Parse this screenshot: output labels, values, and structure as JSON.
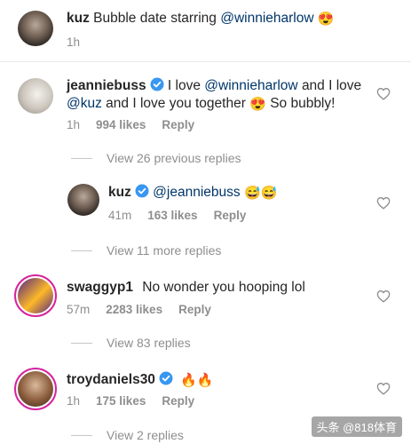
{
  "caption": {
    "username": "kuz",
    "text": "Bubble date starring",
    "mention": "@winnieharlow",
    "emoji": "😍",
    "time": "1h"
  },
  "comments": [
    {
      "username": "jeanniebuss",
      "line1_text_a": "I love",
      "line1_mention": "@winnieharlow",
      "line1_text_b": "and I love",
      "line2_mention": "@kuz",
      "line2_text": "and I love you together",
      "line2_emoji": "😍",
      "line2_text_end": "So bubbly!",
      "time": "1h",
      "likes": "994 likes",
      "reply": "Reply",
      "view_replies": "View 26 previous replies"
    },
    {
      "username": "kuz",
      "mention": "@jeanniebuss",
      "emoji": "😅😅",
      "time": "41m",
      "likes": "163 likes",
      "reply": "Reply",
      "view_replies": "View 11 more replies"
    },
    {
      "username": "swaggyp1",
      "text": "No wonder you hooping lol",
      "time": "57m",
      "likes": "2283 likes",
      "reply": "Reply",
      "view_replies": "View 83 replies"
    },
    {
      "username": "troydaniels30",
      "emoji": "🔥🔥",
      "time": "1h",
      "likes": "175 likes",
      "reply": "Reply",
      "view_replies": "View 2 replies"
    }
  ],
  "watermark": "头条 @818体育",
  "colors": {
    "verified": "#3897f0",
    "mention": "#003569",
    "meta": "#8e8e8e",
    "story_ring": "#d6249f"
  }
}
